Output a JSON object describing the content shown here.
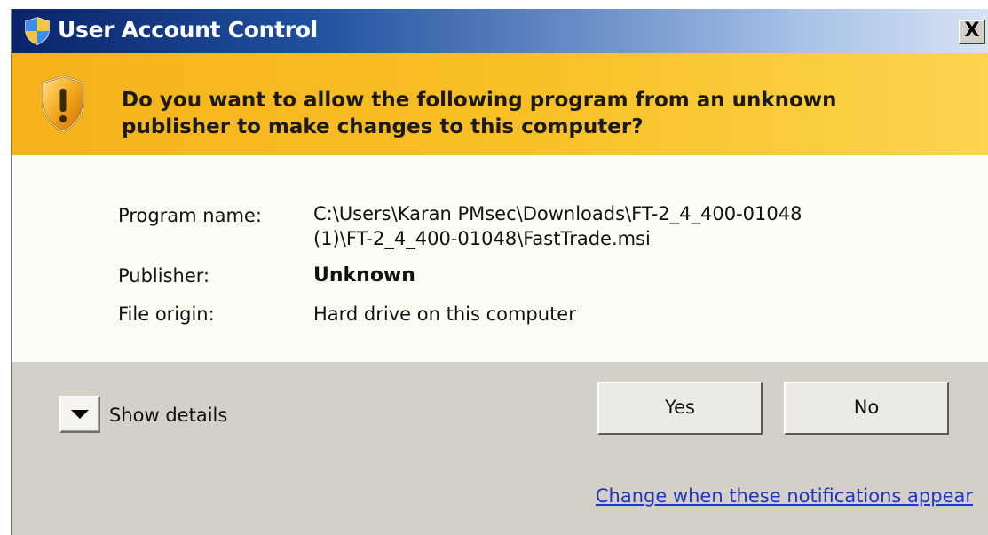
{
  "window": {
    "title": "User Account Control",
    "close_label": "X"
  },
  "banner": {
    "question_line1": "Do you want to allow the following program from an unknown",
    "question_line2": "publisher to make changes to this computer?"
  },
  "details": {
    "program_name_label": "Program name:",
    "program_name_value_line1": "C:\\Users\\Karan PMsec\\Downloads\\FT-2_4_400-01048",
    "program_name_value_line2": "(1)\\FT-2_4_400-01048\\FastTrade.msi",
    "publisher_label": "Publisher:",
    "publisher_value": "Unknown",
    "file_origin_label": "File origin:",
    "file_origin_value": "Hard drive on this computer"
  },
  "footer": {
    "show_details_label": "Show details",
    "yes_label": "Yes",
    "no_label": "No",
    "notifications_link": "Change when these notifications appear"
  },
  "colors": {
    "title_gradient_start": "#0a246a",
    "banner_yellow": "#f9c127",
    "info_background": "#fdfcf5",
    "footer_gray": "#d4d0c8",
    "link_blue": "#2035c4"
  },
  "icons": {
    "title_icon": "uac-shield-icon",
    "banner_icon": "warning-shield-icon",
    "details_toggle_icon": "chevron-down-icon",
    "close_icon": "close-icon"
  }
}
